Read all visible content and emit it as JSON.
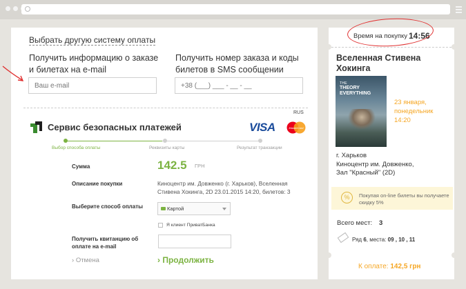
{
  "payment": {
    "other_system_link": "Выбрать другую систему оплаты",
    "email_title": "Получить информацию о заказе и билетах на e-mail",
    "email_placeholder": "Ваш e-mail",
    "sms_title": "Получить номер заказа и коды билетов в SMS сообщении",
    "phone_placeholder": "+38 (___) ___ - __ - __"
  },
  "gateway": {
    "lang": "RUS",
    "title": "Сервис безопасных платежей",
    "visa": "VISA",
    "mastercard": "MasterCard",
    "steps": [
      "Выбор способа оплаты",
      "Реквизиты карты",
      "Результат транзакции"
    ],
    "sum_label": "Сумма",
    "amount": "142.5",
    "currency": "ГРН",
    "desc_label": "Описание покупки",
    "desc_value": "Киноцентр им. Довженко (г. Харьков), Вселенная Стивена Хокинга, 2D 23.01.2015  14:20, билетов: 3",
    "method_label": "Выберите способ оплаты",
    "method_value": "Картой",
    "privat_checkbox": "Я клиент ПриватБанка",
    "receipt_label": "Получить квитанцию об оплате на e-mail",
    "cancel": "Отмена",
    "continue": "Продолжить"
  },
  "sidebar": {
    "timer_label": "Время на покупку",
    "timer_value": "14:56",
    "film_title": "Вселенная Стивена Хокинга",
    "poster_line1": "THE",
    "poster_line2": "THEORY",
    "poster_line3": "EVERYTHING",
    "date_line1": "23 января,",
    "date_line2": "понедельник",
    "date_line3": "14:20",
    "city": "г. Харьков",
    "venue_line1": "Киноцентр им. Довженко,",
    "venue_line2": "Зал \"Красный\" (2D)",
    "discount_symbol": "%",
    "discount_text": "Покупая on-line билеты вы получаете скидку 5%",
    "total_seats_label": "Всего мест:",
    "total_seats": "3",
    "row_label": "Ряд",
    "row_value": "6",
    "seats_label": ", места:",
    "seats_value": "09 , 10 , 11",
    "pay_label": "К оплате:",
    "pay_value": "142,5 грн"
  },
  "colors": {
    "accent_green": "#7cb342",
    "accent_orange": "#f5a623",
    "annotation_red": "#e03030",
    "visa_blue": "#1a4b9b"
  }
}
